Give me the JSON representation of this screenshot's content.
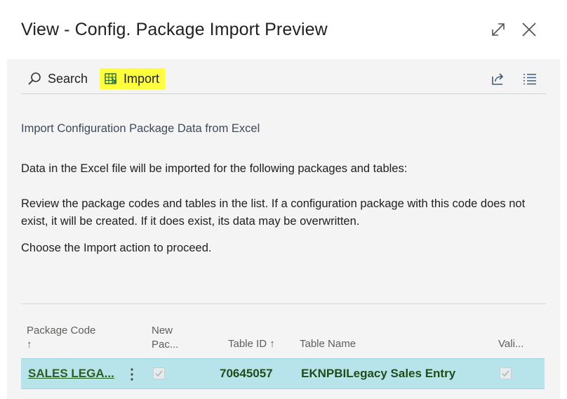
{
  "window": {
    "title": "View - Config. Package Import Preview",
    "expand_icon": "expand-icon",
    "close_icon": "close-icon"
  },
  "toolbar": {
    "search_label": "Search",
    "import_label": "Import",
    "share_icon": "share-icon",
    "list_icon": "list-view-icon",
    "highlight_color": "#ffff3d"
  },
  "content": {
    "heading": "Import Configuration Package Data from Excel",
    "para1": "Data in the Excel file will be imported for the following packages and tables:",
    "para2": "Review the package codes and tables in the list. If a configuration package with this code does not exist, it will be created. If it does exist, its data may be overwritten.",
    "para3": "Choose the Import action to proceed."
  },
  "grid": {
    "columns": {
      "package_code": "Package Code",
      "package_code_sort": "↑",
      "new_package_line1": "New",
      "new_package_line2": "Pac...",
      "table_id": "Table ID ↑",
      "table_name": "Table Name",
      "validate": "Vali..."
    },
    "rows": [
      {
        "package_code": "SALES LEGA...",
        "new_package": true,
        "table_id": "70645057",
        "table_name": "EKNPBILegacy Sales Entry",
        "validate": true
      }
    ],
    "selected_row_color": "#b7e4ea"
  }
}
